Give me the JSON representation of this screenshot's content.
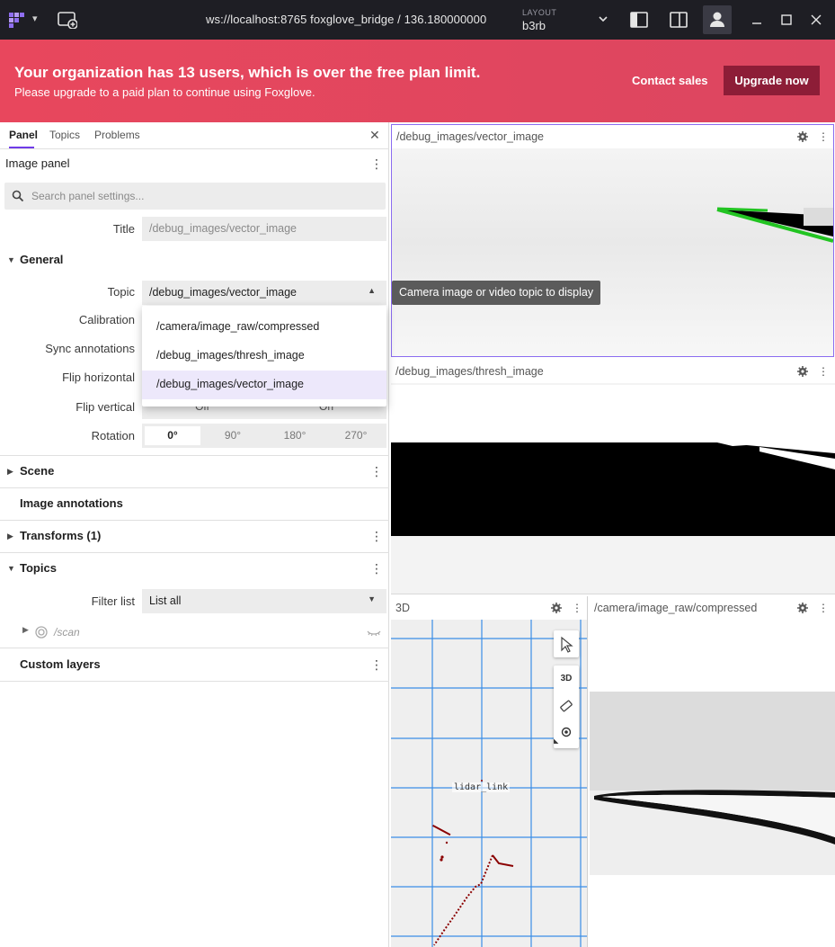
{
  "topbar": {
    "connection": "ws://localhost:8765 foxglove_bridge / 136.180000000",
    "layout_caption": "LAYOUT",
    "layout_name": "b3rb"
  },
  "banner": {
    "title": "Your organization has 13 users, which is over the free plan limit.",
    "subtitle": "Please upgrade to a paid plan to continue using Foxglove.",
    "contact_label": "Contact sales",
    "upgrade_label": "Upgrade now"
  },
  "sidebar": {
    "tabs": [
      "Panel",
      "Topics",
      "Problems"
    ],
    "panel_title": "Image panel",
    "search_placeholder": "Search panel settings...",
    "title_label": "Title",
    "title_value": "/debug_images/vector_image",
    "general": {
      "heading": "General",
      "topic_label": "Topic",
      "topic_value": "/debug_images/vector_image",
      "calibration_label": "Calibration",
      "sync_label": "Sync annotations",
      "flip_h_label": "Flip horizontal",
      "flip_v_label": "Flip vertical",
      "flip_v_options": [
        "Off",
        "On"
      ],
      "rotation_label": "Rotation",
      "rotation_options": [
        "0°",
        "90°",
        "180°",
        "270°"
      ],
      "rotation_selected": "0°"
    },
    "topic_dropdown": {
      "options": [
        "/camera/image_raw/compressed",
        "/debug_images/thresh_image",
        "/debug_images/vector_image"
      ],
      "selected": "/debug_images/vector_image"
    },
    "tooltip": "Camera image or video topic to display",
    "scene_heading": "Scene",
    "image_annotations_heading": "Image annotations",
    "transforms_heading": "Transforms (1)",
    "topics": {
      "heading": "Topics",
      "filter_label": "Filter list",
      "filter_value": "List all",
      "scan_topic": "/scan"
    },
    "custom_layers_heading": "Custom layers"
  },
  "panels": {
    "vector_title": "/debug_images/vector_image",
    "thresh_title": "/debug_images/thresh_image",
    "three_d_title": "3D",
    "camera_title": "/camera/image_raw/compressed",
    "three_d_button": "3D",
    "frame_label": "lidar_link"
  },
  "colors": {
    "accent": "#6f3be8",
    "banner": "#e8475d",
    "upgrade_button": "#8d1d37"
  }
}
